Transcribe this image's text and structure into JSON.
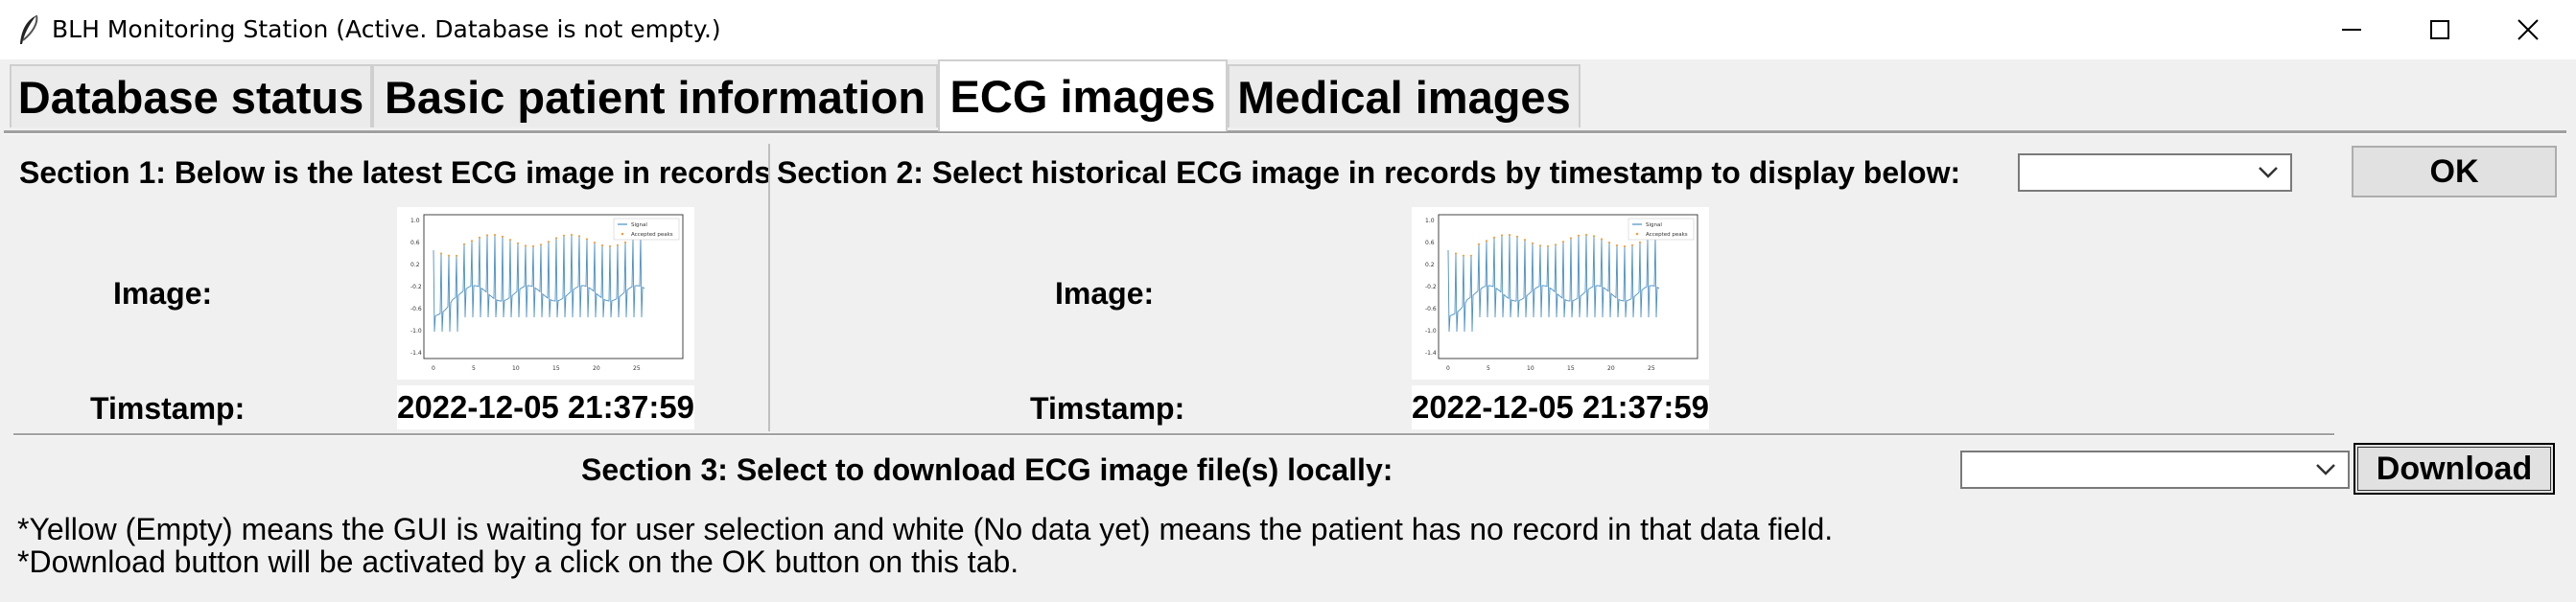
{
  "window": {
    "title": "BLH Monitoring Station (Active. Database is not empty.)",
    "icon": "feather-icon",
    "controls": [
      "minimize-icon",
      "maximize-icon",
      "close-icon"
    ]
  },
  "tabs": [
    {
      "label": "Database status",
      "active": false
    },
    {
      "label": "Basic patient information",
      "active": false
    },
    {
      "label": "ECG images",
      "active": true
    },
    {
      "label": "Medical images",
      "active": false
    }
  ],
  "section1": {
    "heading": "Section 1: Below is the latest ECG image in records",
    "image_label": "Image:",
    "timestamp_label": "Timstamp:",
    "timestamp_value": "2022-12-05 21:37:59"
  },
  "section2": {
    "heading": "Section 2: Select historical ECG image in records by timestamp to display below:",
    "select_value": "",
    "ok_label": "OK",
    "image_label": "Image:",
    "timestamp_label": "Timstamp:",
    "timestamp_value": "2022-12-05 21:37:59"
  },
  "section3": {
    "heading": "Section 3: Select to download ECG image file(s) locally:",
    "select_value": "",
    "download_label": "Download"
  },
  "notes": [
    "*Yellow (Empty) means the GUI is waiting for user selection and white (No data yet) means the patient has no record in that data field.",
    "*Download button will be activated by a click on the OK button on this tab."
  ],
  "ecg_thumbnail": {
    "legend": [
      "Signal",
      "Accepted peaks"
    ],
    "colors": {
      "signal": "#4a90c4",
      "peaks": "#f0a040"
    }
  }
}
